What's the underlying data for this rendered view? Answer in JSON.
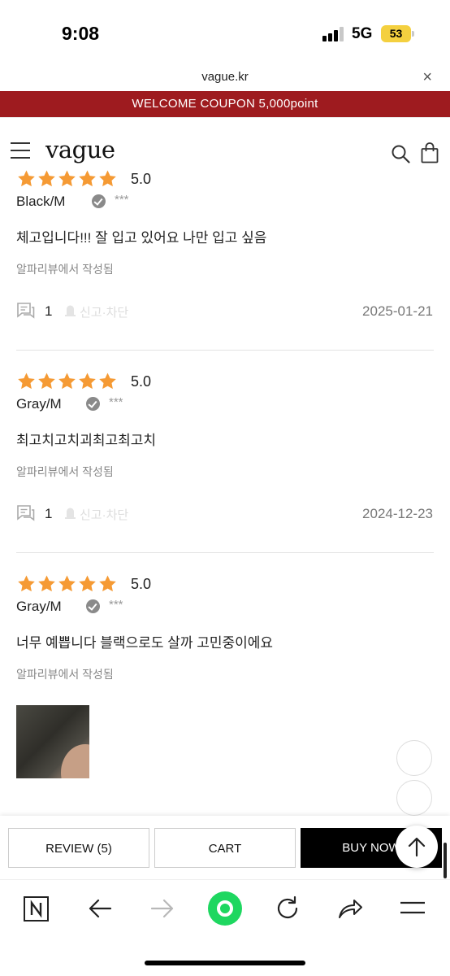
{
  "status_bar": {
    "time": "9:08",
    "network": "5G",
    "battery": "53"
  },
  "browser": {
    "url": "vague.kr",
    "close_symbol": "×"
  },
  "banner": {
    "text": "WELCOME COUPON 5,000point"
  },
  "site": {
    "logo": "vague"
  },
  "reviews": [
    {
      "rating": "5.0",
      "option": "Black/M",
      "author": "***",
      "content": "체고입니다!!! 잘 입고 있어요 나만 입고 싶음",
      "source": "알파리뷰에서 작성됨",
      "comments": "1",
      "report_label": "신고·차단",
      "date": "2025-01-21"
    },
    {
      "rating": "5.0",
      "option": "Gray/M",
      "author": "***",
      "content": "최고치고치괴최고최고치",
      "source": "알파리뷰에서 작성됨",
      "comments": "1",
      "report_label": "신고·차단",
      "date": "2024-12-23"
    },
    {
      "rating": "5.0",
      "option": "Gray/M",
      "author": "***",
      "content": "너무 예쁩니다 블랙으로도 살까 고민중이에요",
      "source": "알파리뷰에서 작성됨"
    }
  ],
  "actions": {
    "review": "REVIEW (5)",
    "cart": "CART",
    "buy": "BUY NOW"
  },
  "colors": {
    "banner": "#9e1b1f",
    "star": "#f59a34",
    "buy_button": "#000000",
    "browser_accent": "#1ed760"
  },
  "icons": [
    "menu-icon",
    "search-icon",
    "shopping-bag-icon",
    "verified-check-icon",
    "comment-icon",
    "report-icon",
    "scroll-top-icon",
    "naver-home-icon",
    "back-arrow-icon",
    "forward-arrow-icon",
    "green-dot-icon",
    "refresh-icon",
    "share-icon",
    "hamburger-menu-icon"
  ]
}
